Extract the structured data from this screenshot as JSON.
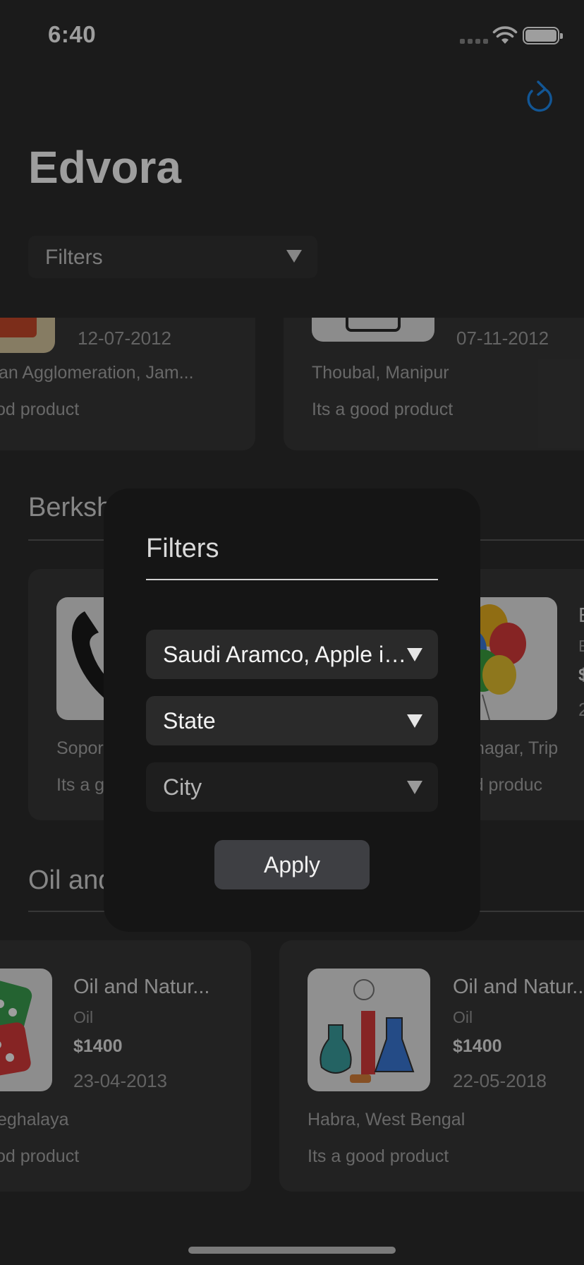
{
  "status_bar": {
    "time": "6:40"
  },
  "header": {
    "title": "Edvora",
    "refresh_icon": "refresh-icon"
  },
  "filter_bar": {
    "label": "Filters"
  },
  "top_cards": [
    {
      "date": "12-07-2012",
      "location": "an Agglomeration, Jam...",
      "description": "od product"
    },
    {
      "date": "07-11-2012",
      "location": "Thoubal, Manipur",
      "description": "Its a good product"
    }
  ],
  "sections": [
    {
      "title": "Berksh",
      "cards": [
        {
          "location": "Sopor",
          "description": "Its a g"
        },
        {
          "title": "E",
          "sub": "E",
          "price": "$",
          "date": "2",
          "location": "rmanagar, Trip",
          "description": "good produc"
        }
      ]
    },
    {
      "title": "Oil and",
      "cards": [
        {
          "title": "Oil and Natur...",
          "category": "Oil",
          "price": "$1400",
          "date": "23-04-2013",
          "location": "eghalaya",
          "description": "od product"
        },
        {
          "title": "Oil and Natur...",
          "category": "Oil",
          "price": "$1400",
          "date": "22-05-2018",
          "location": "Habra, West Bengal",
          "description": "Its a good product"
        }
      ]
    }
  ],
  "modal": {
    "title": "Filters",
    "product_select": "Saudi Aramco, Apple in...",
    "state_select": "State",
    "city_select": "City",
    "apply_label": "Apply"
  }
}
